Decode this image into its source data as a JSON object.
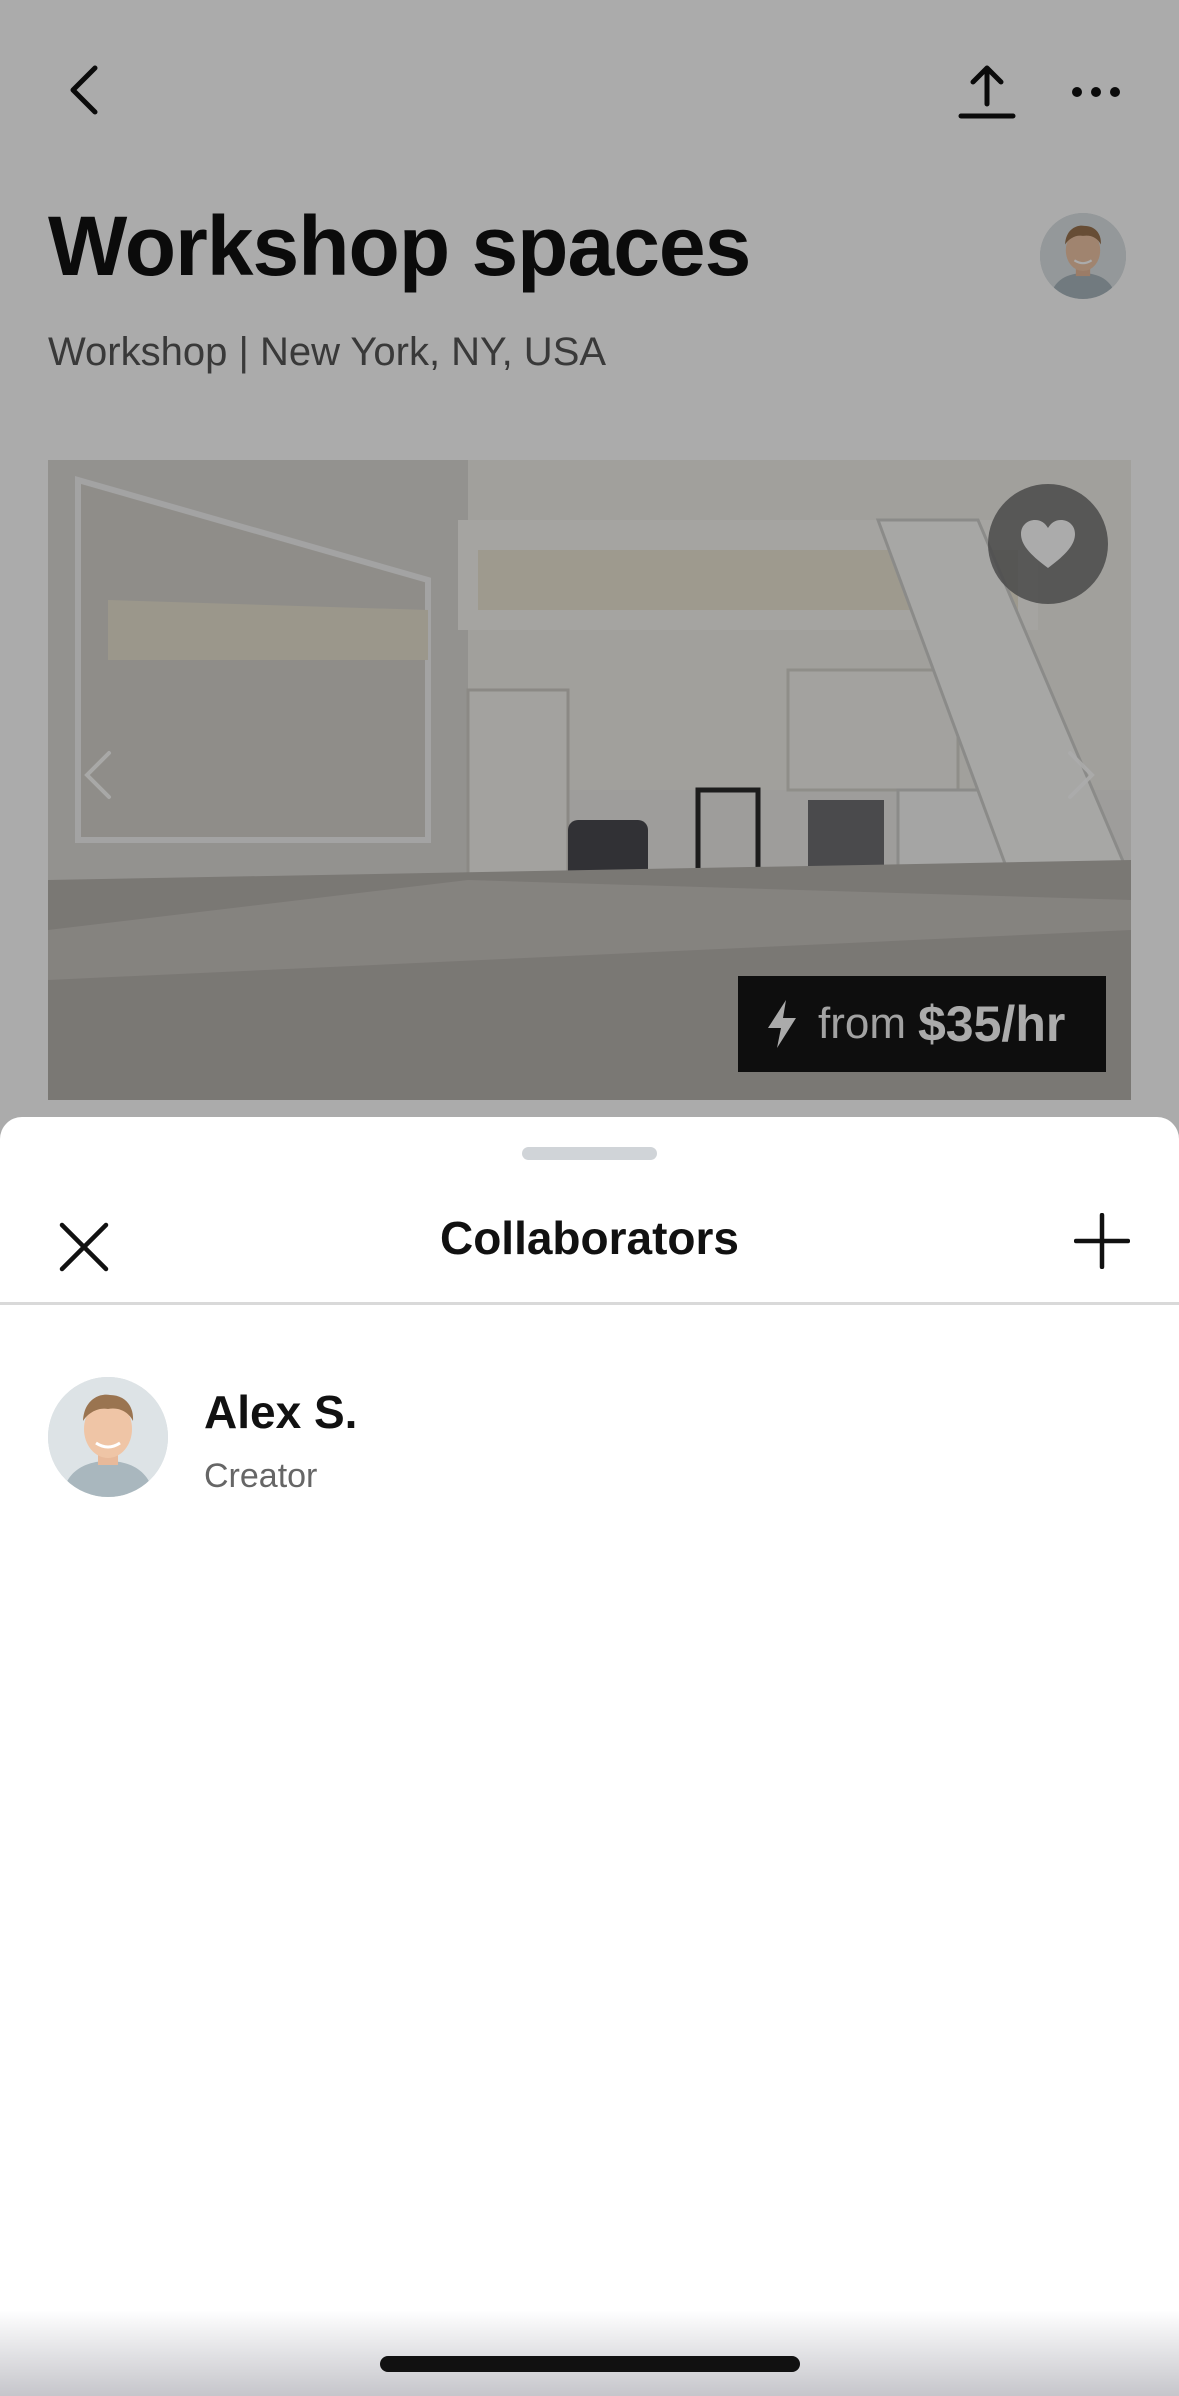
{
  "listing": {
    "title": "Workshop spaces",
    "subtitle": "Workshop | New York, NY, USA",
    "price_from": "from",
    "price_amount": "$35/hr"
  },
  "icons": {
    "back": "chevron-left-icon",
    "share": "share-upload-icon",
    "more": "more-dots-icon",
    "favorite": "heart-icon",
    "instant_book": "lightning-bolt-icon",
    "close": "close-x-icon",
    "add": "plus-icon"
  },
  "sheet": {
    "title": "Collaborators",
    "collaborators": [
      {
        "name": "Alex S.",
        "role": "Creator"
      }
    ]
  },
  "colors": {
    "overlay": "#000000",
    "badge_bg": "#151515",
    "divider": "#d9d9d9"
  }
}
